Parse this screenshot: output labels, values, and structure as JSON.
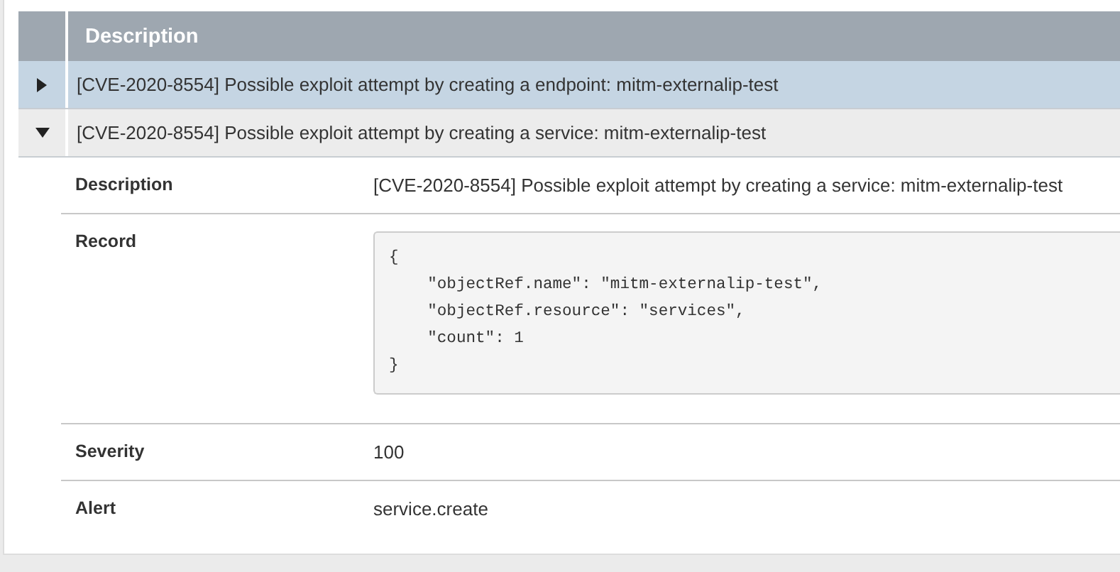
{
  "table": {
    "columns": [
      "Description"
    ],
    "rows": [
      {
        "description": "[CVE-2020-8554] Possible exploit attempt by creating a endpoint: mitm-externalip-test",
        "selected": true,
        "expanded": false
      },
      {
        "description": "[CVE-2020-8554] Possible exploit attempt by creating a service: mitm-externalip-test",
        "selected": false,
        "expanded": true,
        "details": [
          {
            "kind": "text",
            "label": "Description",
            "value": "[CVE-2020-8554] Possible exploit attempt by creating a service: mitm-externalip-test"
          },
          {
            "kind": "code",
            "label": "Record",
            "value": "{\n    \"objectRef.name\": \"mitm-externalip-test\",\n    \"objectRef.resource\": \"services\",\n    \"count\": 1\n}"
          },
          {
            "kind": "text",
            "label": "Severity",
            "value": "100"
          },
          {
            "kind": "text",
            "label": "Alert",
            "value": "service.create"
          }
        ]
      }
    ]
  }
}
